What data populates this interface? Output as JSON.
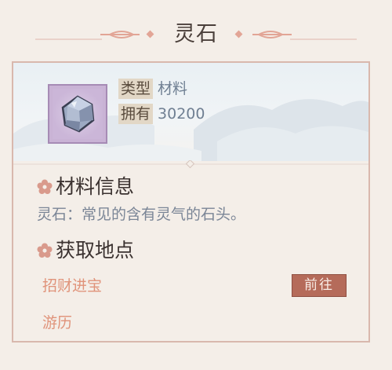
{
  "header": {
    "title": "灵石"
  },
  "item": {
    "icon": "gem-icon",
    "type_label": "类型",
    "type_value": "材料",
    "owned_label": "拥有",
    "owned_value": "30200"
  },
  "info_section": {
    "heading": "材料信息",
    "description": "灵石：常见的含有灵气的石头。"
  },
  "source_section": {
    "heading": "获取地点",
    "sources": [
      {
        "name": "招财进宝",
        "button": "前往"
      },
      {
        "name": "游历"
      }
    ]
  },
  "colors": {
    "panel_bg": "#f4eee8",
    "frame_border": "#d9b8ad",
    "accent_pink": "#e0937a",
    "button_bg": "#b56b5a",
    "slot_purple": "#c9b3d5"
  }
}
